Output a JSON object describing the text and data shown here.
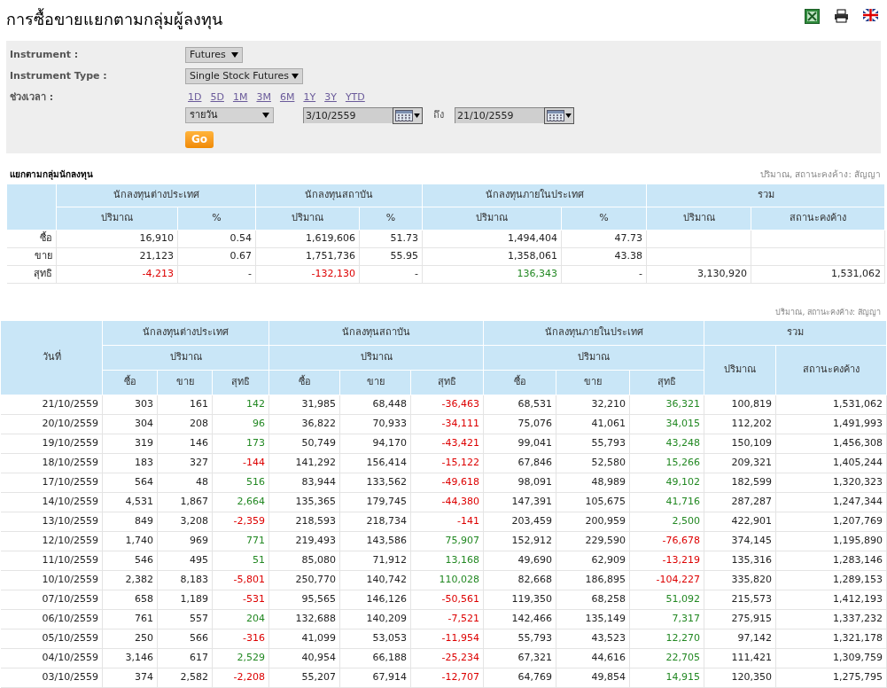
{
  "title": "การซื้อขายแยกตามกลุ่มผู้ลงทุน",
  "filters": {
    "instrument_label": "Instrument :",
    "instrument": "Futures",
    "instrument_type_label": "Instrument Type :",
    "instrument_type": "Single Stock Futures",
    "period_label": "ช่วงเวลา :",
    "ranges": [
      "1D",
      "5D",
      "1M",
      "3M",
      "6M",
      "1Y",
      "3Y",
      "YTD"
    ],
    "frequency": "รายวัน",
    "from": "3/10/2559",
    "to_label": "ถึง",
    "to": "21/10/2559",
    "go": "Go"
  },
  "summary": {
    "title": "แยกตามกลุ่มนักลงทุน",
    "unit_note": "ปริมาณ, สถานะคงค้าง: สัญญา",
    "groups": [
      "นักลงทุนต่างประเทศ",
      "นักลงทุนสถาบัน",
      "นักลงทุนภายในประเทศ",
      "รวม"
    ],
    "columns": [
      "ปริมาณ",
      "%",
      "ปริมาณ",
      "%",
      "ปริมาณ",
      "%",
      "ปริมาณ",
      "สถานะคงค้าง"
    ],
    "rows": [
      {
        "label": "ซื้อ",
        "cells": [
          {
            "text": "16,910"
          },
          {
            "text": "0.54"
          },
          {
            "text": "1,619,606"
          },
          {
            "text": "51.73"
          },
          {
            "text": "1,494,404"
          },
          {
            "text": "47.73"
          }
        ]
      },
      {
        "label": "ขาย",
        "cells": [
          {
            "text": "21,123"
          },
          {
            "text": "0.67"
          },
          {
            "text": "1,751,736"
          },
          {
            "text": "55.95"
          },
          {
            "text": "1,358,061"
          },
          {
            "text": "43.38"
          }
        ]
      },
      {
        "label": "สุทธิ",
        "cells": [
          {
            "text": "-4,213",
            "color": "#dd0000"
          },
          {
            "text": "-"
          },
          {
            "text": "-132,130",
            "color": "#dd0000"
          },
          {
            "text": "-"
          },
          {
            "text": "136,343",
            "color": "#228822"
          },
          {
            "text": "-"
          },
          {
            "text": "3,130,920"
          },
          {
            "text": "1,531,062"
          }
        ]
      }
    ]
  },
  "daily": {
    "unit_note": "ปริมาณ, สถานะคงค้าง: สัญญา",
    "date_header": "วันที่",
    "groups": [
      {
        "name": "นักลงทุนต่างประเทศ",
        "sub_header": "ปริมาณ",
        "columns": [
          "ซื้อ",
          "ขาย",
          "สุทธิ"
        ]
      },
      {
        "name": "นักลงทุนสถาบัน",
        "sub_header": "ปริมาณ",
        "columns": [
          "ซื้อ",
          "ขาย",
          "สุทธิ"
        ]
      },
      {
        "name": "นักลงทุนภายในประเทศ",
        "sub_header": "ปริมาณ",
        "columns": [
          "ซื้อ",
          "ขาย",
          "สุทธิ"
        ]
      },
      {
        "name": "รวม",
        "columns": [
          "ปริมาณ",
          "สถานะคงค้าง"
        ]
      }
    ],
    "rows": [
      {
        "date": "21/10/2559",
        "cells": [
          {
            "text": "303"
          },
          {
            "text": "161"
          },
          {
            "text": "142",
            "color": "#228822"
          },
          {
            "text": "31,985"
          },
          {
            "text": "68,448"
          },
          {
            "text": "-36,463",
            "color": "#dd0000"
          },
          {
            "text": "68,531"
          },
          {
            "text": "32,210"
          },
          {
            "text": "36,321",
            "color": "#228822"
          },
          {
            "text": "100,819"
          },
          {
            "text": "1,531,062"
          }
        ]
      },
      {
        "date": "20/10/2559",
        "cells": [
          {
            "text": "304"
          },
          {
            "text": "208"
          },
          {
            "text": "96",
            "color": "#228822"
          },
          {
            "text": "36,822"
          },
          {
            "text": "70,933"
          },
          {
            "text": "-34,111",
            "color": "#dd0000"
          },
          {
            "text": "75,076"
          },
          {
            "text": "41,061"
          },
          {
            "text": "34,015",
            "color": "#228822"
          },
          {
            "text": "112,202"
          },
          {
            "text": "1,491,993"
          }
        ]
      },
      {
        "date": "19/10/2559",
        "cells": [
          {
            "text": "319"
          },
          {
            "text": "146"
          },
          {
            "text": "173",
            "color": "#228822"
          },
          {
            "text": "50,749"
          },
          {
            "text": "94,170"
          },
          {
            "text": "-43,421",
            "color": "#dd0000"
          },
          {
            "text": "99,041"
          },
          {
            "text": "55,793"
          },
          {
            "text": "43,248",
            "color": "#228822"
          },
          {
            "text": "150,109"
          },
          {
            "text": "1,456,308"
          }
        ]
      },
      {
        "date": "18/10/2559",
        "cells": [
          {
            "text": "183"
          },
          {
            "text": "327"
          },
          {
            "text": "-144",
            "color": "#dd0000"
          },
          {
            "text": "141,292"
          },
          {
            "text": "156,414"
          },
          {
            "text": "-15,122",
            "color": "#dd0000"
          },
          {
            "text": "67,846"
          },
          {
            "text": "52,580"
          },
          {
            "text": "15,266",
            "color": "#228822"
          },
          {
            "text": "209,321"
          },
          {
            "text": "1,405,244"
          }
        ]
      },
      {
        "date": "17/10/2559",
        "cells": [
          {
            "text": "564"
          },
          {
            "text": "48"
          },
          {
            "text": "516",
            "color": "#228822"
          },
          {
            "text": "83,944"
          },
          {
            "text": "133,562"
          },
          {
            "text": "-49,618",
            "color": "#dd0000"
          },
          {
            "text": "98,091"
          },
          {
            "text": "48,989"
          },
          {
            "text": "49,102",
            "color": "#228822"
          },
          {
            "text": "182,599"
          },
          {
            "text": "1,320,323"
          }
        ]
      },
      {
        "date": "14/10/2559",
        "cells": [
          {
            "text": "4,531"
          },
          {
            "text": "1,867"
          },
          {
            "text": "2,664",
            "color": "#228822"
          },
          {
            "text": "135,365"
          },
          {
            "text": "179,745"
          },
          {
            "text": "-44,380",
            "color": "#dd0000"
          },
          {
            "text": "147,391"
          },
          {
            "text": "105,675"
          },
          {
            "text": "41,716",
            "color": "#228822"
          },
          {
            "text": "287,287"
          },
          {
            "text": "1,247,344"
          }
        ]
      },
      {
        "date": "13/10/2559",
        "cells": [
          {
            "text": "849"
          },
          {
            "text": "3,208"
          },
          {
            "text": "-2,359",
            "color": "#dd0000"
          },
          {
            "text": "218,593"
          },
          {
            "text": "218,734"
          },
          {
            "text": "-141",
            "color": "#dd0000"
          },
          {
            "text": "203,459"
          },
          {
            "text": "200,959"
          },
          {
            "text": "2,500",
            "color": "#228822"
          },
          {
            "text": "422,901"
          },
          {
            "text": "1,207,769"
          }
        ]
      },
      {
        "date": "12/10/2559",
        "cells": [
          {
            "text": "1,740"
          },
          {
            "text": "969"
          },
          {
            "text": "771",
            "color": "#228822"
          },
          {
            "text": "219,493"
          },
          {
            "text": "143,586"
          },
          {
            "text": "75,907",
            "color": "#228822"
          },
          {
            "text": "152,912"
          },
          {
            "text": "229,590"
          },
          {
            "text": "-76,678",
            "color": "#dd0000"
          },
          {
            "text": "374,145"
          },
          {
            "text": "1,195,890"
          }
        ]
      },
      {
        "date": "11/10/2559",
        "cells": [
          {
            "text": "546"
          },
          {
            "text": "495"
          },
          {
            "text": "51",
            "color": "#228822"
          },
          {
            "text": "85,080"
          },
          {
            "text": "71,912"
          },
          {
            "text": "13,168",
            "color": "#228822"
          },
          {
            "text": "49,690"
          },
          {
            "text": "62,909"
          },
          {
            "text": "-13,219",
            "color": "#dd0000"
          },
          {
            "text": "135,316"
          },
          {
            "text": "1,283,146"
          }
        ]
      },
      {
        "date": "10/10/2559",
        "cells": [
          {
            "text": "2,382"
          },
          {
            "text": "8,183"
          },
          {
            "text": "-5,801",
            "color": "#dd0000"
          },
          {
            "text": "250,770"
          },
          {
            "text": "140,742"
          },
          {
            "text": "110,028",
            "color": "#228822"
          },
          {
            "text": "82,668"
          },
          {
            "text": "186,895"
          },
          {
            "text": "-104,227",
            "color": "#dd0000"
          },
          {
            "text": "335,820"
          },
          {
            "text": "1,289,153"
          }
        ]
      },
      {
        "date": "07/10/2559",
        "cells": [
          {
            "text": "658"
          },
          {
            "text": "1,189"
          },
          {
            "text": "-531",
            "color": "#dd0000"
          },
          {
            "text": "95,565"
          },
          {
            "text": "146,126"
          },
          {
            "text": "-50,561",
            "color": "#dd0000"
          },
          {
            "text": "119,350"
          },
          {
            "text": "68,258"
          },
          {
            "text": "51,092",
            "color": "#228822"
          },
          {
            "text": "215,573"
          },
          {
            "text": "1,412,193"
          }
        ]
      },
      {
        "date": "06/10/2559",
        "cells": [
          {
            "text": "761"
          },
          {
            "text": "557"
          },
          {
            "text": "204",
            "color": "#228822"
          },
          {
            "text": "132,688"
          },
          {
            "text": "140,209"
          },
          {
            "text": "-7,521",
            "color": "#dd0000"
          },
          {
            "text": "142,466"
          },
          {
            "text": "135,149"
          },
          {
            "text": "7,317",
            "color": "#228822"
          },
          {
            "text": "275,915"
          },
          {
            "text": "1,337,232"
          }
        ]
      },
      {
        "date": "05/10/2559",
        "cells": [
          {
            "text": "250"
          },
          {
            "text": "566"
          },
          {
            "text": "-316",
            "color": "#dd0000"
          },
          {
            "text": "41,099"
          },
          {
            "text": "53,053"
          },
          {
            "text": "-11,954",
            "color": "#dd0000"
          },
          {
            "text": "55,793"
          },
          {
            "text": "43,523"
          },
          {
            "text": "12,270",
            "color": "#228822"
          },
          {
            "text": "97,142"
          },
          {
            "text": "1,321,178"
          }
        ]
      },
      {
        "date": "04/10/2559",
        "cells": [
          {
            "text": "3,146"
          },
          {
            "text": "617"
          },
          {
            "text": "2,529",
            "color": "#228822"
          },
          {
            "text": "40,954"
          },
          {
            "text": "66,188"
          },
          {
            "text": "-25,234",
            "color": "#dd0000"
          },
          {
            "text": "67,321"
          },
          {
            "text": "44,616"
          },
          {
            "text": "22,705",
            "color": "#228822"
          },
          {
            "text": "111,421"
          },
          {
            "text": "1,309,759"
          }
        ]
      },
      {
        "date": "03/10/2559",
        "cells": [
          {
            "text": "374"
          },
          {
            "text": "2,582"
          },
          {
            "text": "-2,208",
            "color": "#dd0000"
          },
          {
            "text": "55,207"
          },
          {
            "text": "67,914"
          },
          {
            "text": "-12,707",
            "color": "#dd0000"
          },
          {
            "text": "64,769"
          },
          {
            "text": "49,854"
          },
          {
            "text": "14,915",
            "color": "#228822"
          },
          {
            "text": "120,350"
          },
          {
            "text": "1,275,795"
          }
        ]
      }
    ]
  }
}
